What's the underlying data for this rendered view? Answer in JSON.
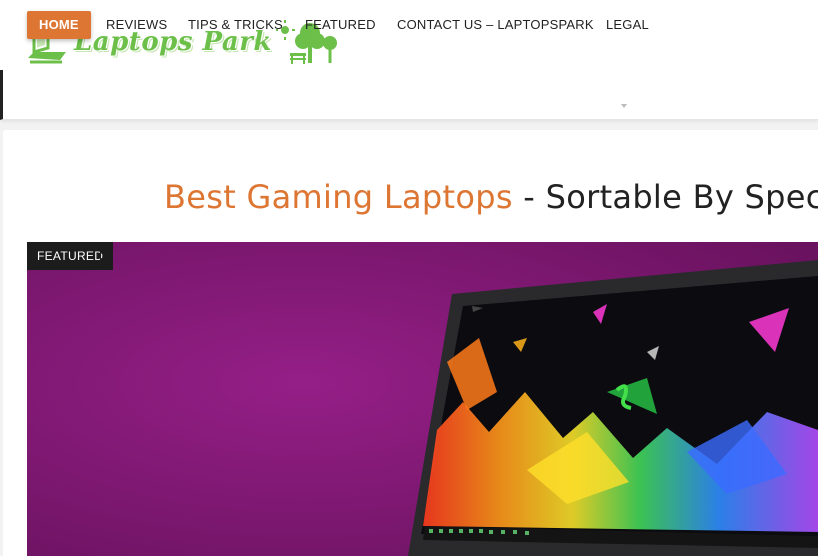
{
  "header": {
    "logo_text": "Laptops Park"
  },
  "nav": {
    "items": [
      {
        "label": "HOME",
        "active": true
      },
      {
        "label": "REVIEWS"
      },
      {
        "label": "TIPS & TRICKS"
      },
      {
        "label": "FEATURED"
      },
      {
        "label": "CONTACT US – LAPTOPSPARK"
      },
      {
        "label": "LEGAL",
        "has_dropdown": true
      }
    ]
  },
  "article": {
    "title_highlight": "Best Gaming Laptops",
    "title_rest": " - Sortable By Specs,",
    "badge": "FEATURED",
    "hero_image": "laptop-with-colorful-abstract-wallpaper"
  },
  "colors": {
    "accent": "#dd7633",
    "logo_green": "#6cc04a",
    "hero_background": "#8a1e7e",
    "badge_background": "#1c1c1c"
  }
}
